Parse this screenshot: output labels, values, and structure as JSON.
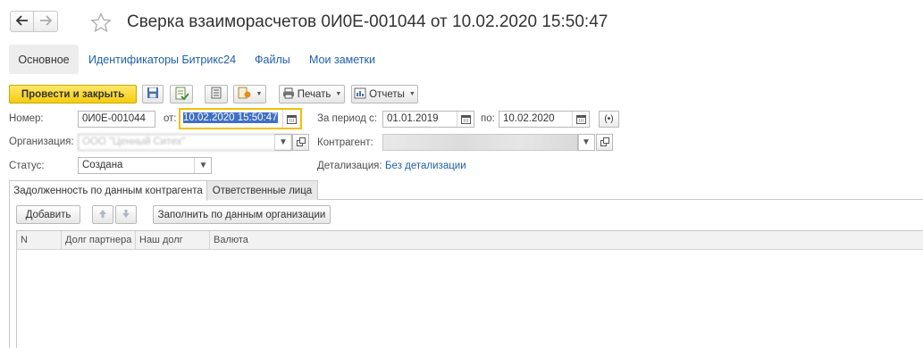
{
  "window": {
    "title": "Сверка взаиморасчетов 0И0Е-001044 от 10.02.2020 15:50:47"
  },
  "top_tabs": [
    {
      "label": "Основное",
      "active": true
    },
    {
      "label": "Идентификаторы Битрикс24"
    },
    {
      "label": "Файлы"
    },
    {
      "label": "Мои заметки"
    }
  ],
  "toolbar": {
    "post_close_label": "Провести и закрыть",
    "print_label": "Печать",
    "reports_label": "Отчеты"
  },
  "form": {
    "number_label": "Номер:",
    "number_value": "0И0Е-001044",
    "date_label": "от:",
    "date_value": "10.02.2020 15:50:47",
    "period_label": "За период с:",
    "period_from": "01.01.2019",
    "period_to_label": "по:",
    "period_to": "10.02.2020",
    "org_label": "Организация:",
    "org_value": "ООО \"Ценный Ситех\"",
    "contractor_label": "Контрагент:",
    "status_label": "Статус:",
    "status_value": "Создана",
    "detail_label": "Детализация:",
    "detail_value": "Без детализации"
  },
  "inner_tabs": [
    {
      "label": "Задолженность по данным контрагента",
      "active": true
    },
    {
      "label": "Ответственные лица"
    }
  ],
  "table_toolbar": {
    "add_label": "Добавить",
    "fill_label": "Заполнить по данным организации"
  },
  "table": {
    "columns": [
      "N",
      "Долг партнера",
      "Наш долг",
      "Валюта"
    ],
    "rows": []
  },
  "colors": {
    "accent_yellow": "#f5cc0c",
    "link_blue": "#1f5fa8",
    "focus_border": "#f0c000",
    "selection": "#3f6fc4"
  }
}
